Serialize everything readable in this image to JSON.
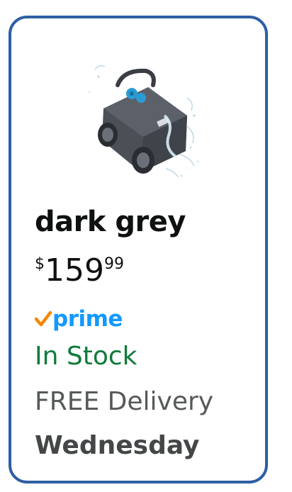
{
  "product": {
    "image_icon": "pool-robot-cleaner-image",
    "variant_name": "dark grey",
    "price": {
      "symbol": "$",
      "whole": "159",
      "fraction": "99"
    },
    "prime_label": "prime",
    "stock_status": "In Stock",
    "delivery_label": "FREE Delivery",
    "delivery_day": "Wednesday"
  },
  "colors": {
    "border": "#2f5fa3",
    "prime_blue": "#1399ff",
    "prime_check": "#f08804",
    "in_stock_green": "#0f7b3a",
    "muted_text": "#565959"
  }
}
